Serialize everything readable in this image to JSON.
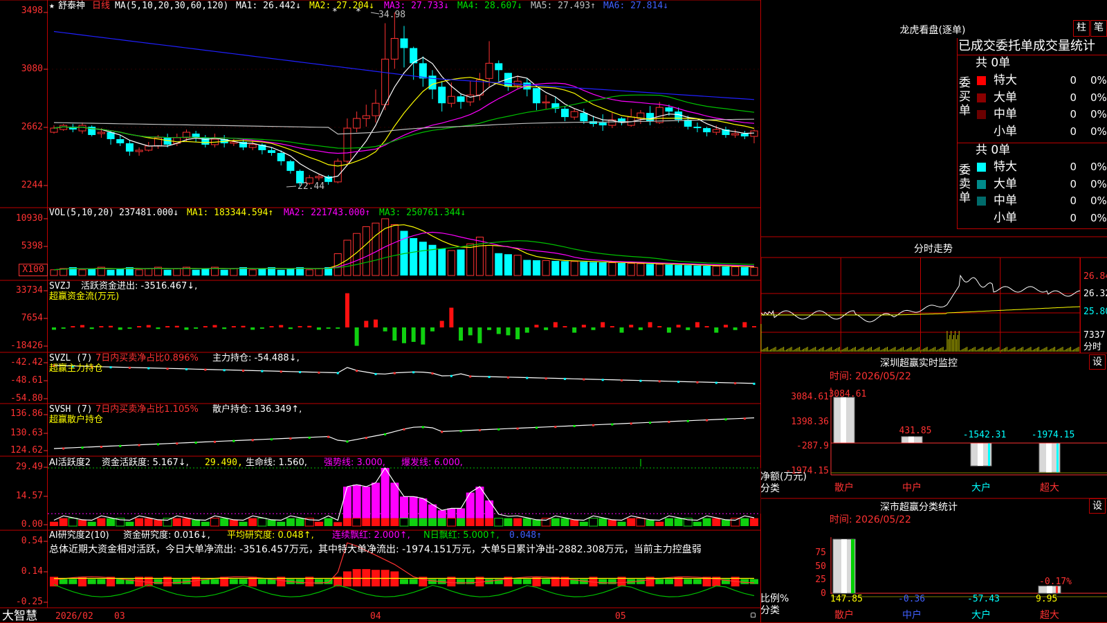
{
  "colors": {
    "up": "#ff3232",
    "down": "#00ffff",
    "grid": "#c00000",
    "ma1": "#ffffff",
    "ma2": "#ffff00",
    "ma3": "#ff00ff",
    "ma4": "#00c000",
    "ma5": "#c0c0c0",
    "ma6": "#2020ff"
  },
  "kline": {
    "star_icon": "★",
    "stock_name": "舒泰神",
    "period": "日线",
    "ma_params": "MA(5,10,20,30,60,120)",
    "ma1": "MA1: 26.442↓",
    "ma2": "MA2: 27.204↓",
    "ma3": "MA3: 27.733↓",
    "ma4": "MA4: 28.607↓",
    "ma5": "MA5: 27.493↑",
    "ma6": "MA6: 27.814↓",
    "yaxis": [
      "3498",
      "3080",
      "2662",
      "2244"
    ],
    "high_label": "34.98",
    "low_label": "22.44",
    "mark_glyph": "*",
    "candles": [
      [
        26.3,
        26.6,
        26.2,
        26.8
      ],
      [
        26.5,
        26.8,
        26.4,
        26.9
      ],
      [
        26.7,
        26.5,
        26.3,
        26.9
      ],
      [
        26.4,
        26.8,
        26.2,
        27.0
      ],
      [
        26.7,
        26.1,
        26.0,
        26.8
      ],
      [
        26.2,
        26.3,
        25.9,
        26.6
      ],
      [
        26.3,
        25.8,
        25.4,
        26.4
      ],
      [
        25.8,
        25.5,
        25.3,
        26.1
      ],
      [
        25.5,
        24.9,
        24.6,
        25.7
      ],
      [
        24.9,
        25.0,
        24.6,
        25.2
      ],
      [
        25.0,
        25.3,
        24.9,
        25.6
      ],
      [
        25.3,
        25.9,
        25.1,
        26.1
      ],
      [
        25.9,
        25.4,
        25.2,
        26.2
      ],
      [
        25.5,
        25.9,
        25.3,
        26.2
      ],
      [
        25.9,
        26.3,
        25.6,
        26.5
      ],
      [
        26.2,
        25.9,
        25.6,
        26.4
      ],
      [
        25.9,
        25.4,
        25.2,
        26.1
      ],
      [
        25.4,
        25.8,
        25.2,
        26.2
      ],
      [
        25.8,
        25.5,
        25.2,
        26.1
      ],
      [
        25.5,
        25.6,
        25.3,
        25.8
      ],
      [
        25.6,
        25.2,
        25.0,
        25.8
      ],
      [
        25.2,
        25.4,
        25.0,
        25.7
      ],
      [
        25.4,
        25.0,
        24.7,
        25.5
      ],
      [
        25.0,
        24.8,
        24.6,
        25.2
      ],
      [
        24.8,
        24.2,
        23.9,
        25.0
      ],
      [
        24.2,
        23.5,
        23.3,
        24.3
      ],
      [
        23.5,
        22.6,
        22.4,
        23.6
      ],
      [
        22.6,
        23.0,
        22.5,
        23.2
      ],
      [
        23.0,
        23.1,
        22.8,
        23.3
      ],
      [
        23.1,
        22.7,
        22.5,
        23.2
      ],
      [
        22.7,
        24.2,
        22.6,
        24.4
      ],
      [
        24.2,
        26.6,
        24.0,
        27.3
      ],
      [
        26.6,
        27.3,
        26.3,
        27.8
      ],
      [
        27.3,
        27.5,
        26.7,
        28.3
      ],
      [
        27.5,
        28.4,
        27.0,
        29.4
      ],
      [
        28.3,
        31.6,
        27.9,
        34.2
      ],
      [
        31.6,
        33.1,
        30.9,
        34.98
      ],
      [
        33.1,
        32.4,
        31.0,
        34.0
      ],
      [
        32.4,
        31.3,
        30.1,
        32.5
      ],
      [
        31.3,
        30.2,
        29.6,
        31.8
      ],
      [
        30.4,
        29.4,
        28.7,
        30.8
      ],
      [
        29.6,
        28.4,
        27.8,
        30.0
      ],
      [
        28.4,
        28.9,
        28.1,
        29.9
      ],
      [
        28.9,
        28.5,
        28.0,
        29.1
      ],
      [
        28.5,
        29.0,
        28.2,
        30.0
      ],
      [
        29.0,
        30.1,
        28.6,
        30.6
      ],
      [
        30.2,
        31.3,
        29.6,
        32.9
      ],
      [
        31.3,
        30.8,
        30.0,
        31.5
      ],
      [
        30.6,
        29.6,
        29.3,
        30.6
      ],
      [
        29.7,
        30.0,
        29.4,
        30.4
      ],
      [
        29.9,
        29.4,
        28.9,
        30.2
      ],
      [
        29.5,
        28.4,
        27.9,
        29.5
      ],
      [
        28.5,
        28.5,
        28.0,
        29.0
      ],
      [
        28.4,
        28.0,
        27.7,
        28.9
      ],
      [
        28.0,
        27.4,
        27.1,
        28.2
      ],
      [
        27.4,
        27.8,
        27.2,
        28.0
      ],
      [
        27.7,
        27.1,
        26.9,
        28.0
      ],
      [
        27.1,
        26.9,
        26.7,
        27.5
      ],
      [
        27.0,
        26.8,
        26.4,
        27.6
      ],
      [
        26.8,
        27.2,
        26.6,
        27.7
      ],
      [
        27.3,
        27.0,
        26.8,
        27.4
      ],
      [
        26.8,
        27.4,
        26.7,
        28.0
      ],
      [
        27.3,
        27.7,
        26.9,
        27.9
      ],
      [
        27.7,
        27.1,
        26.8,
        28.2
      ],
      [
        27.0,
        28.1,
        26.9,
        28.5
      ],
      [
        28.1,
        27.8,
        27.5,
        28.3
      ],
      [
        27.8,
        27.2,
        27.0,
        28.1
      ],
      [
        27.2,
        26.7,
        26.5,
        27.5
      ],
      [
        26.7,
        26.6,
        26.3,
        27.0
      ],
      [
        26.6,
        26.3,
        26.0,
        26.7
      ],
      [
        26.3,
        26.5,
        26.1,
        26.8
      ],
      [
        26.5,
        26.1,
        25.9,
        26.7
      ],
      [
        26.1,
        26.2,
        25.9,
        26.5
      ],
      [
        26.2,
        26.0,
        25.8,
        26.4
      ],
      [
        26.0,
        26.4,
        25.5,
        26.5
      ]
    ]
  },
  "vol": {
    "header": "VOL(5,10,20)",
    "value": "237481.000↓",
    "ma1": "MA1: 183344.594↑",
    "ma2": "MA2: 221743.000↑",
    "ma3": "MA3: 250761.344↓",
    "yaxis": [
      "10930",
      "5398"
    ],
    "unit": "X100"
  },
  "svzj": {
    "header": "SVZJ",
    "label": "活跃资金进出: -3516.467↓,",
    "subtitle": "超赢资金流(万元)",
    "yaxis": [
      "33734",
      "7654",
      "-18426"
    ]
  },
  "svzl": {
    "header": "SVZL (7)",
    "pct": "7日内买卖净占比0.896%",
    "hold": "主力持仓: -54.488↓,",
    "subtitle": "超赢主力持仓",
    "yaxis": [
      "-42.42",
      "-48.61",
      "-54.80"
    ]
  },
  "svsh": {
    "header": "SVSH (7)",
    "pct": "7日内买卖净占比1.105%",
    "hold": "散户持仓: 136.349↑,",
    "subtitle": "超赢散户持仓",
    "yaxis": [
      "136.86",
      "130.63",
      "124.62"
    ]
  },
  "ai_active": {
    "header": "AI活跃度2",
    "zj": "资金活跃度: 5.167↓,",
    "v2": "29.490,",
    "life": "生命线: 1.560,",
    "strong": "强势线: 3.000,",
    "burst": "爆发线: 6.000,",
    "yaxis": [
      "29.49",
      "14.57",
      "0.00"
    ]
  },
  "ai_research": {
    "header": "AI研究度2(10)",
    "zj": "资金研究度: 0.016↓,",
    "avg": "平均研究度: 0.048↑,",
    "lx": "连续飘红: 2.000↑,",
    "n": "N日飘红: 5.000↑,",
    "v": "0.048↑",
    "summary": "总体近期大资金相对活跃，今日大单净流出: -3516.457万元，其中特大单净流出: -1974.151万元，大单5日累计净出-2882.308万元，当前主力控盘弱",
    "yaxis": [
      "0.54",
      "0.14",
      "-0.25"
    ]
  },
  "xaxis": {
    "brand": "大智慧",
    "labels": [
      "2026/02",
      "03",
      "04",
      "05"
    ]
  },
  "dragon": {
    "title": "龙虎看盘(逐单)",
    "btn_bar": "柱",
    "btn_tick": "笔",
    "header": "已成交委托单成交量统计",
    "buy_label": "委买单",
    "sell_label": "委卖单",
    "total": "共 0单",
    "buy_rows": [
      [
        "特大",
        "0",
        "0%"
      ],
      [
        "大单",
        "0",
        "0%"
      ],
      [
        "中单",
        "0",
        "0%"
      ],
      [
        "小单",
        "0",
        "0%"
      ]
    ],
    "sell_rows": [
      [
        "特大",
        "0",
        "0%"
      ],
      [
        "大单",
        "0",
        "0%"
      ],
      [
        "中单",
        "0",
        "0%"
      ],
      [
        "小单",
        "0",
        "0%"
      ]
    ]
  },
  "intraday": {
    "title": "分时走势",
    "right_labels": [
      "26.84",
      "26.32",
      "25.80",
      "7337",
      "分时"
    ]
  },
  "monitor": {
    "title": "深圳超赢实时监控",
    "btn": "设",
    "time": "时间: 2026/05/22",
    "yaxis": [
      "3084.61",
      "1398.36",
      "-287.9",
      "-1974.15"
    ],
    "ylabel": "净额(万元)",
    "xlabel": "分类",
    "bars": [
      {
        "cat": "散户",
        "value": 3084.61,
        "label": "3084.61"
      },
      {
        "cat": "中户",
        "value": 431.85,
        "label": "431.85"
      },
      {
        "cat": "大户",
        "value": -1542.31,
        "label": "-1542.31"
      },
      {
        "cat": "超大",
        "value": -1974.15,
        "label": "-1974.15"
      }
    ]
  },
  "classify": {
    "title": "深市超赢分类统计",
    "btn": "设",
    "time": "时间: 2026/05/22",
    "yaxis": [
      "75",
      "50",
      "25",
      "0"
    ],
    "ylabel": "比例%",
    "xlabel": "分类",
    "cats": [
      "散户",
      "中户",
      "大户",
      "超大"
    ],
    "values": [
      "147.85",
      "-0.36",
      "-57.43",
      "9.95"
    ],
    "extra": "-0.17%"
  },
  "chart_data": [
    {
      "type": "bar",
      "title": "深圳超赢实时监控",
      "categories": [
        "散户",
        "中户",
        "大户",
        "超大"
      ],
      "values": [
        3084.61,
        431.85,
        -1542.31,
        -1974.15
      ],
      "ylabel": "净额(万元)",
      "xlabel": "分类",
      "ylim": [
        -1974.15,
        3084.61
      ]
    },
    {
      "type": "bar",
      "title": "深市超赢分类统计",
      "categories": [
        "散户",
        "中户",
        "大户",
        "超大"
      ],
      "values": [
        147.85,
        -0.36,
        -57.43,
        9.95
      ],
      "ylabel": "比例%",
      "xlabel": "分类",
      "ylim": [
        0,
        75
      ]
    }
  ]
}
